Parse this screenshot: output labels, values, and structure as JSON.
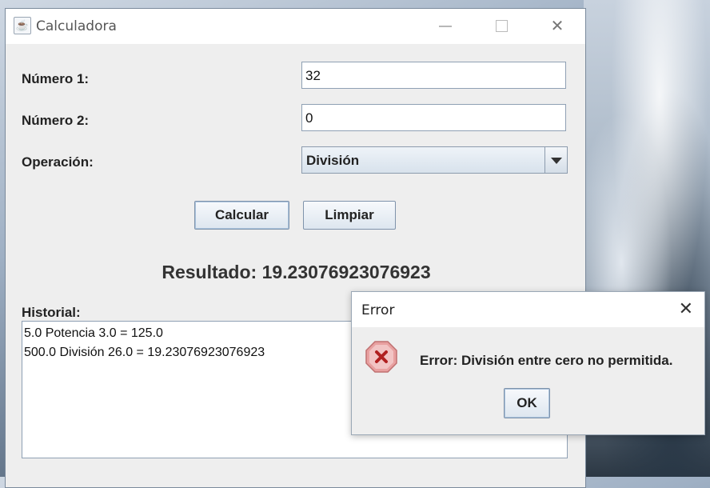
{
  "window": {
    "title": "Calculadora"
  },
  "form": {
    "num1_label": "Número 1:",
    "num1_value": "32",
    "num2_label": "Número 2:",
    "num2_value": "0",
    "op_label": "Operación:",
    "op_value": "División"
  },
  "buttons": {
    "calculate": "Calcular",
    "clear": "Limpiar"
  },
  "result": "Resultado: 19.23076923076923",
  "history": {
    "label": "Historial:",
    "items": [
      "5.0 Potencia 3.0 = 125.0",
      "500.0 División 26.0 = 19.23076923076923"
    ]
  },
  "dialog": {
    "title": "Error",
    "message": "Error: División entre cero no permitida.",
    "ok": "OK",
    "icon": "error-icon"
  }
}
